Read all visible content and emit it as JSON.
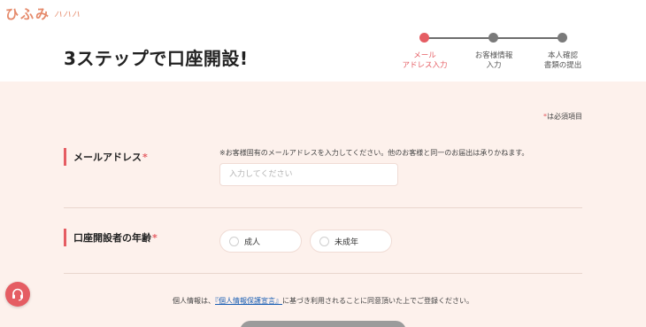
{
  "header": {
    "logo_main": "ひふみ",
    "logo_sub": "ハハハ",
    "page_title": "3ステップで口座開設!"
  },
  "stepper": {
    "active_color": "#e55d63",
    "inactive_color": "#7a7a7a",
    "steps": [
      {
        "label": "メール\nアドレス入力",
        "active": true
      },
      {
        "label": "お客様情報\n入力",
        "active": false
      },
      {
        "label": "本人確認\n書類の提出",
        "active": false
      }
    ]
  },
  "form": {
    "required_note_mark": "*",
    "required_note_text": "は必須項目",
    "email": {
      "label": "メールアドレス",
      "required_mark": "*",
      "note": "※お客様固有のメールアドレスを入力してください。他のお客様と同一のお届出は承りかねます。",
      "placeholder": "入力してください",
      "value": ""
    },
    "age": {
      "label": "口座開設者の年齢",
      "required_mark": "*",
      "options": [
        "成人",
        "未成年"
      ]
    },
    "privacy": {
      "prefix": "個人情報は、",
      "link": "『個人情報保護宣言』",
      "suffix": "に基づき利用されることに同意頂いた上でご登録ください。"
    }
  },
  "help": {
    "icon": "headset-icon"
  }
}
